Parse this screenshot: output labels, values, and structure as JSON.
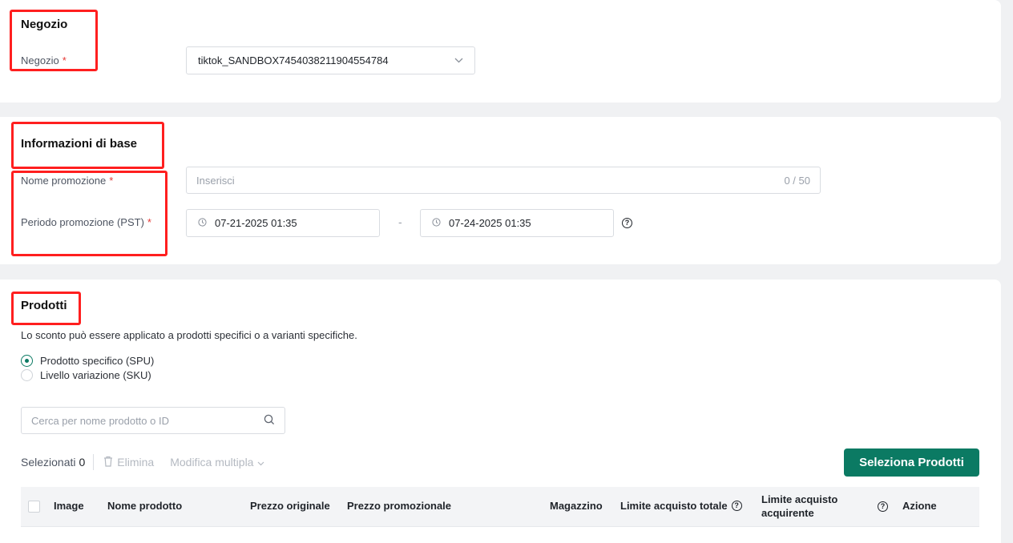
{
  "store": {
    "title": "Negozio",
    "label": "Negozio",
    "required": "*",
    "selected_store": "tiktok_SANDBOX7454038211904554784"
  },
  "basic_info": {
    "title": "Informazioni di base",
    "name_label": "Nome promozione",
    "name_placeholder": "Inserisci",
    "name_counter": "0 / 50",
    "period_label": "Periodo promozione (PST)",
    "required": "*",
    "start_date": "07-21-2025 01:35",
    "separator": "-",
    "end_date": "07-24-2025 01:35"
  },
  "products": {
    "title": "Prodotti",
    "description": "Lo sconto può essere applicato a prodotti specifici o a varianti specifiche.",
    "options": [
      {
        "label": "Prodotto specifico (SPU)",
        "selected": true
      },
      {
        "label": "Livello variazione (SKU)",
        "selected": false
      }
    ],
    "search_placeholder": "Cerca per nome prodotto o ID",
    "selected_label": "Selezionati",
    "selected_count": "0",
    "delete_label": "Elimina",
    "bulk_edit_label": "Modifica multipla",
    "select_button": "Seleziona Prodotti",
    "columns": {
      "image": "Image",
      "name": "Nome prodotto",
      "original_price": "Prezzo originale",
      "promo_price": "Prezzo promozionale",
      "stock": "Magazzino",
      "total_limit": "Limite acquisto totale",
      "buyer_limit": "Limite acquisto acquirente",
      "action": "Azione"
    }
  },
  "colors": {
    "accent": "#0b7a63",
    "required": "#e53935",
    "highlight": "#ff1f1f"
  },
  "icons": [
    "chevron-down-icon",
    "clock-icon",
    "help-icon",
    "search-icon",
    "trash-icon"
  ]
}
